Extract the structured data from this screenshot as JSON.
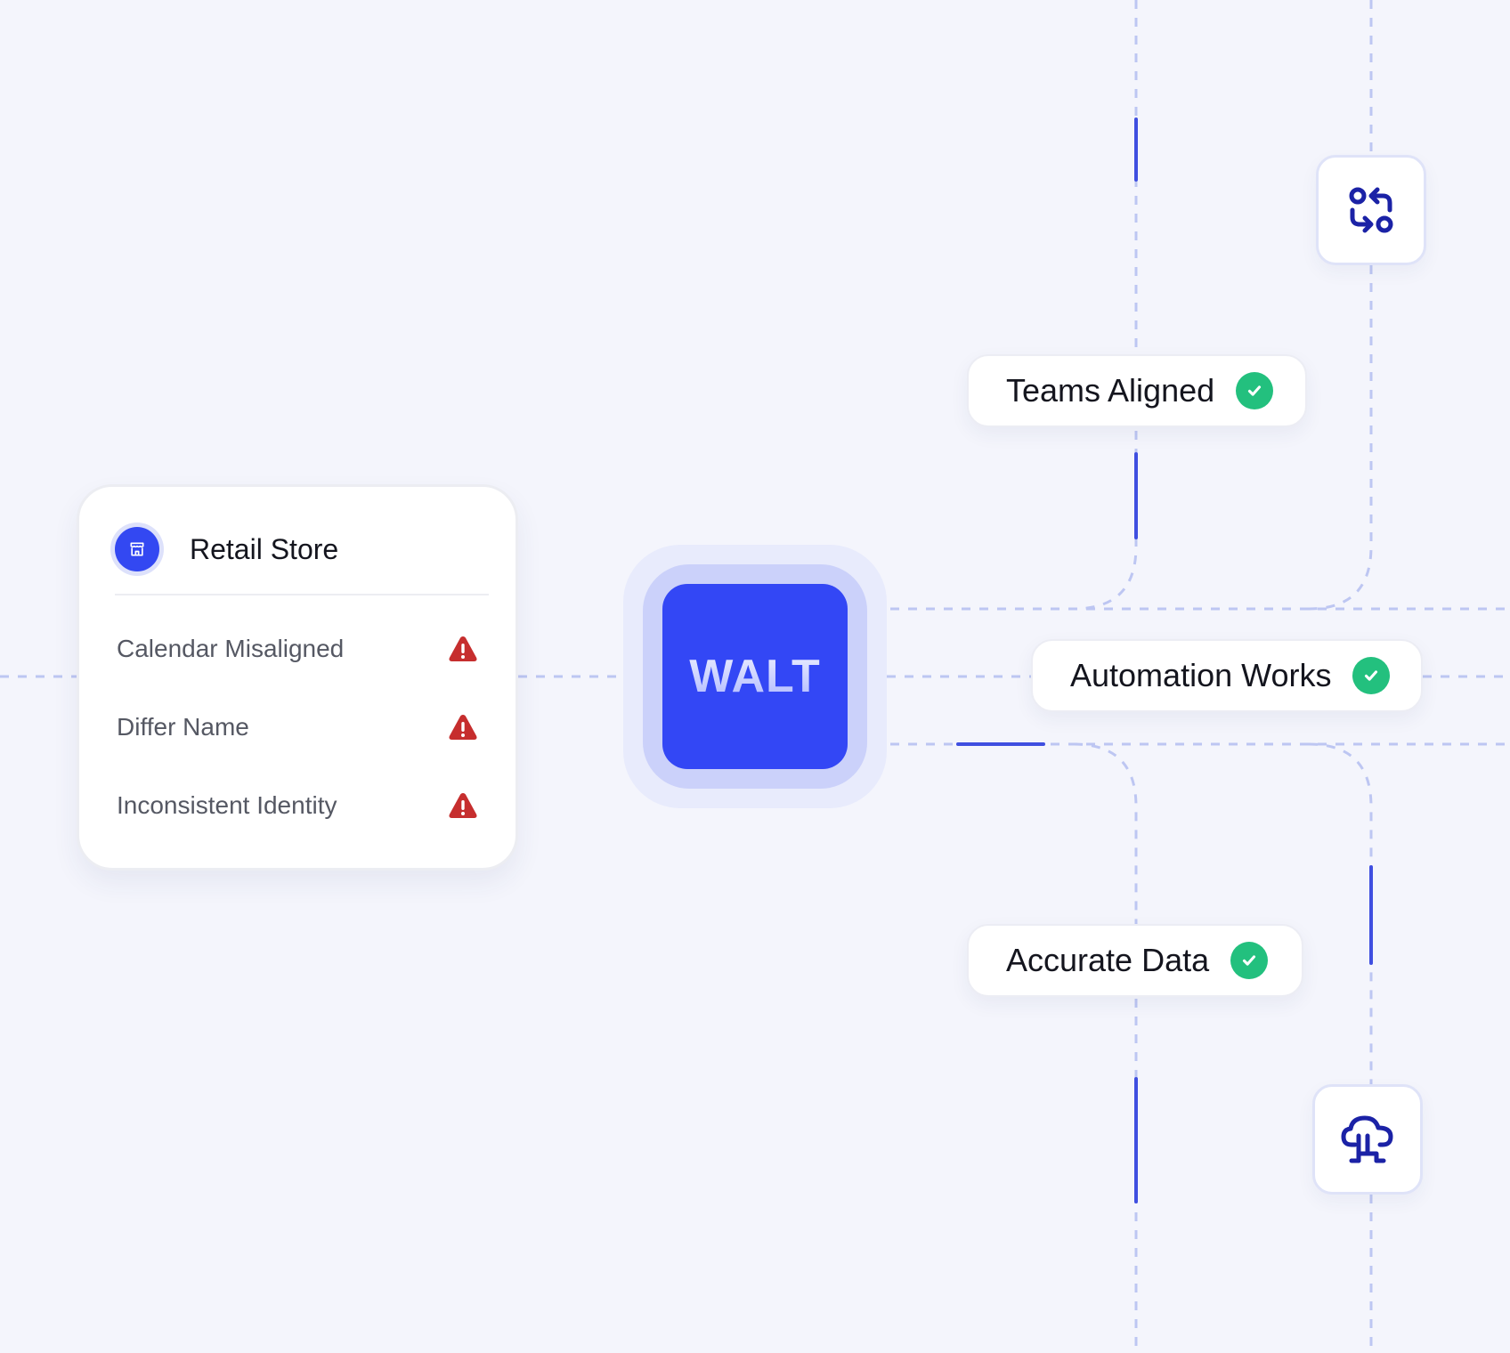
{
  "card": {
    "title": "Retail Store",
    "store_icon": "store-icon",
    "issues": [
      {
        "label": "Calendar Misaligned",
        "icon": "warning-icon"
      },
      {
        "label": "Differ Name",
        "icon": "warning-icon"
      },
      {
        "label": "Inconsistent Identity",
        "icon": "warning-icon"
      }
    ]
  },
  "hub": {
    "label": "WALT"
  },
  "outcomes": [
    {
      "label": "Teams Aligned",
      "icon": "check-icon"
    },
    {
      "label": "Automation Works",
      "icon": "check-icon"
    },
    {
      "label": "Accurate Data",
      "icon": "check-icon"
    }
  ],
  "tiles": [
    {
      "icon": "sync-arrows-icon"
    },
    {
      "icon": "cloud-network-icon"
    }
  ],
  "colors": {
    "background": "#F4F5FC",
    "brand": "#3347F5",
    "success": "#23C07E",
    "warning": "#C62E2E",
    "connector": "#BDC6F2",
    "connector_active": "#3F4FE0",
    "icon_dark": "#1B22A6"
  }
}
